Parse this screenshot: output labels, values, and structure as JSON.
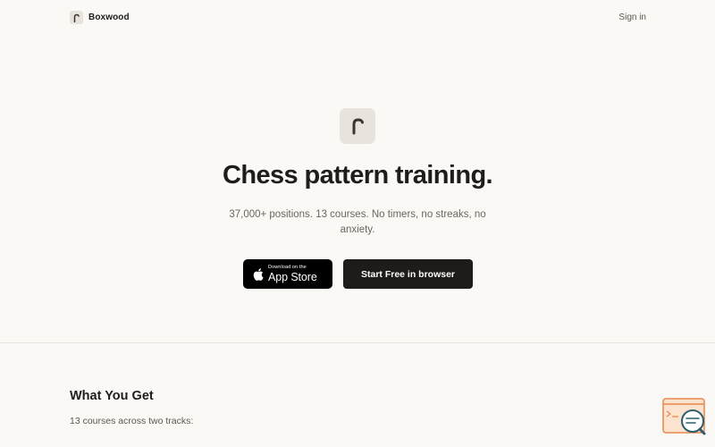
{
  "header": {
    "brand_name": "Boxwood",
    "signin_label": "Sign in"
  },
  "hero": {
    "title": "Chess pattern training.",
    "subtitle": "37,000+ positions. 13 courses. No timers, no streaks, no anxiety.",
    "appstore": {
      "small": "Download on the",
      "big": "App Store"
    },
    "start_label": "Start Free in browser"
  },
  "section": {
    "title": "What You Get",
    "subtitle": "13 courses across two tracks:"
  },
  "icons": {
    "brand": "knight-logo-icon",
    "apple": "apple-icon",
    "help": "help-widget-icon"
  },
  "colors": {
    "background": "#faf9f6",
    "logo_tile": "#e8e3dc",
    "button_dark": "#1e1b18",
    "text": "#1f1c19",
    "muted": "#6b665f",
    "widget_accent": "#e8874a"
  }
}
